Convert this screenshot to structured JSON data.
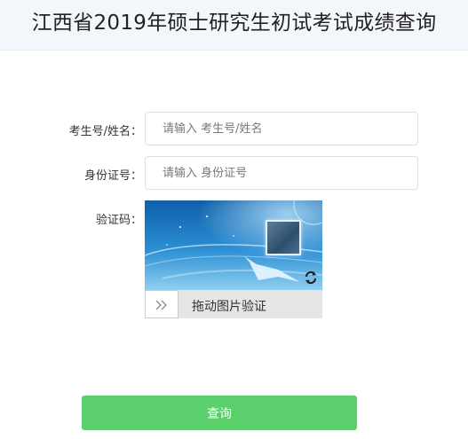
{
  "header": {
    "title": "江西省2019年硕士研究生初试考试成绩查询"
  },
  "form": {
    "exam_label": "考生号/姓名：",
    "exam_placeholder": "请输入 考生号/姓名",
    "exam_value": "",
    "id_label": "身份证号：",
    "id_placeholder": "请输入 身份证号",
    "id_value": "",
    "captcha_label": "验证码："
  },
  "captcha": {
    "slider_icon": "double-chevron-right-icon",
    "slider_text": "拖动图片验证",
    "refresh_icon": "refresh-icon"
  },
  "submit": {
    "label": "查询"
  },
  "colors": {
    "header_bg": "#f3f7fb",
    "button": "#5bcf6b",
    "slider_bar": "#e6e6e6"
  }
}
